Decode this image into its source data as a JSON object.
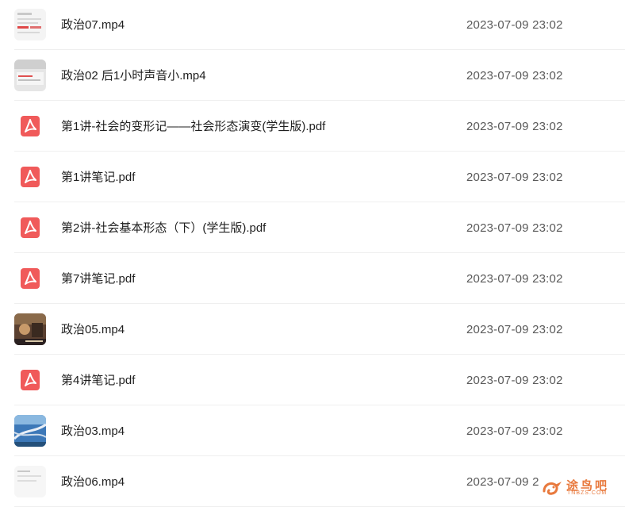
{
  "files": [
    {
      "name": "政治07.mp4",
      "date": "2023-07-09 23:02",
      "icon": "video-thumbnail-document"
    },
    {
      "name": "政治02 后1小时声音小.mp4",
      "date": "2023-07-09 23:02",
      "icon": "video-thumbnail-screen"
    },
    {
      "name": "第1讲-社会的变形记——社会形态演变(学生版).pdf",
      "date": "2023-07-09 23:02",
      "icon": "pdf-icon"
    },
    {
      "name": "第1讲笔记.pdf",
      "date": "2023-07-09 23:02",
      "icon": "pdf-icon"
    },
    {
      "name": "第2讲-社会基本形态（下）(学生版).pdf",
      "date": "2023-07-09 23:02",
      "icon": "pdf-icon"
    },
    {
      "name": "第7讲笔记.pdf",
      "date": "2023-07-09 23:02",
      "icon": "pdf-icon"
    },
    {
      "name": "政治05.mp4",
      "date": "2023-07-09 23:02",
      "icon": "video-thumbnail-photo"
    },
    {
      "name": "第4讲笔记.pdf",
      "date": "2023-07-09 23:02",
      "icon": "pdf-icon"
    },
    {
      "name": "政治03.mp4",
      "date": "2023-07-09 23:02",
      "icon": "video-thumbnail-highway"
    },
    {
      "name": "政治06.mp4",
      "date": "2023-07-09 2",
      "icon": "video-thumbnail-document"
    }
  ],
  "watermark": {
    "text": "途鸟吧",
    "sub": "TNBZS.COM"
  },
  "colors": {
    "pdf": "#f05a5a",
    "date": "#595959",
    "watermark": "#e8793d"
  }
}
